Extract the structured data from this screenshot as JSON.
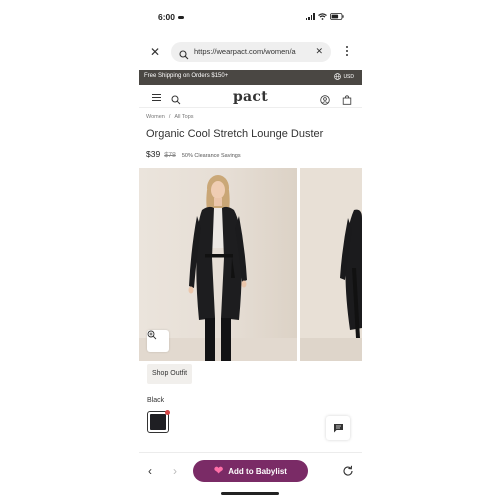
{
  "status_bar": {
    "time": "6:00"
  },
  "browser": {
    "url": "https://wearpact.com/women/a",
    "icons": {
      "close": "close-icon",
      "search": "search-icon",
      "clear": "clear-icon",
      "menu": "more-vertical-icon"
    }
  },
  "promo": {
    "text": "Free Shipping on Orders $150+",
    "region": "USD"
  },
  "site": {
    "logo": "pact"
  },
  "breadcrumb": [
    "Women",
    "/",
    "All Tops"
  ],
  "product": {
    "title": "Organic Cool Stretch Lounge Duster",
    "price": "$39",
    "original_price": "$78",
    "savings": "50% Clearance Savings",
    "shop_outfit_label": "Shop Outfit",
    "color_label": "Black",
    "swatch_color": "#1f1f23"
  },
  "bottom_bar": {
    "add_label": "Add to Babylist",
    "accent": "#7a2b66"
  },
  "colors": {
    "promo_bg": "#4a4743",
    "photo_bg": "#e6ded5"
  }
}
